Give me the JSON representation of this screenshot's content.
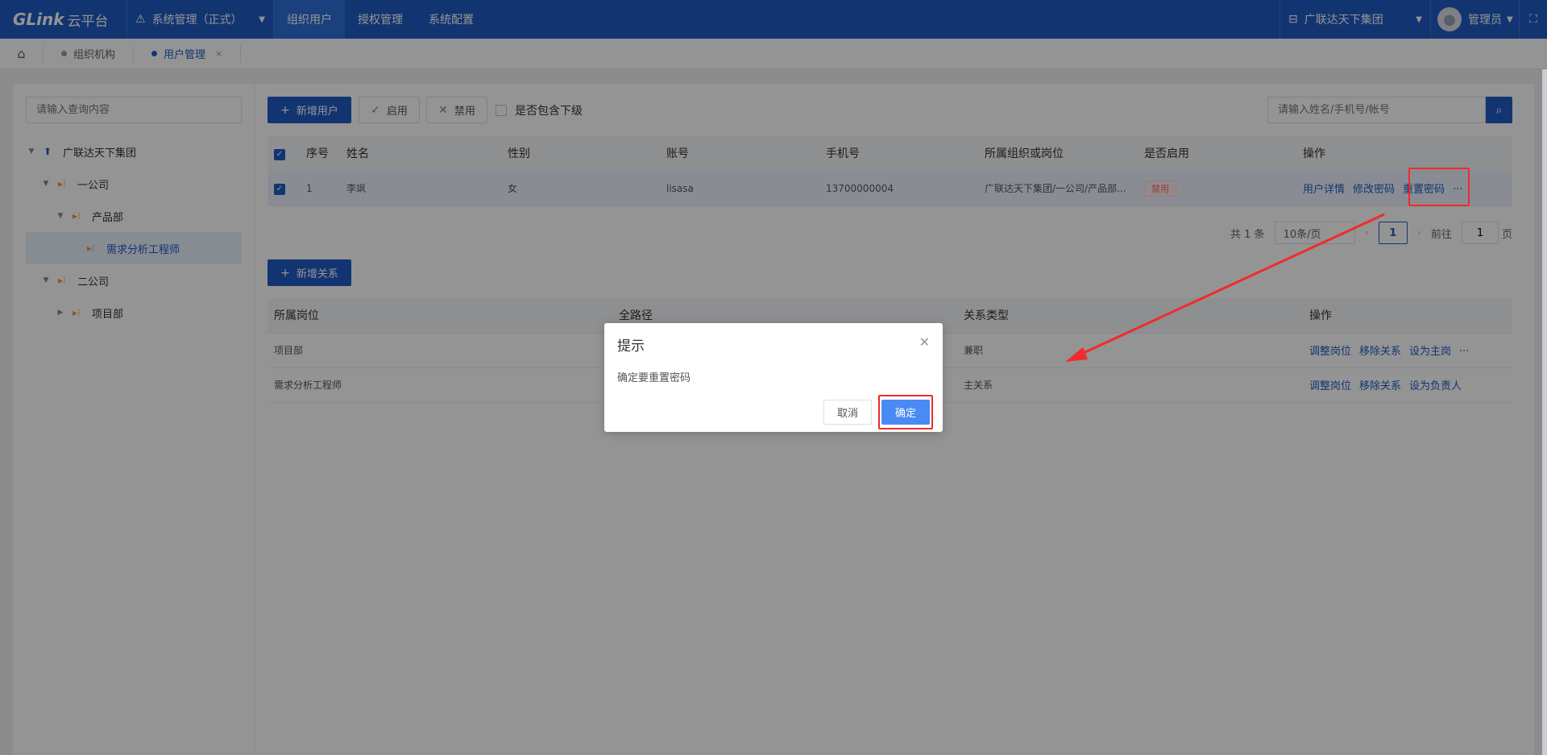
{
  "header": {
    "logo_main": "GLink",
    "logo_suffix": "云平台",
    "system_menu": "系统管理（正式）",
    "nav_tabs": [
      {
        "label": "组织用户",
        "active": true
      },
      {
        "label": "授权管理"
      },
      {
        "label": "系统配置"
      }
    ],
    "org_select": "广联达天下集团",
    "user_name": "管理员"
  },
  "page_tabs": [
    {
      "label": "组织机构"
    },
    {
      "label": "用户管理",
      "active": true
    }
  ],
  "tree": {
    "search_placeholder": "请输入查询内容",
    "nodes": [
      {
        "label": "广联达天下集团",
        "expanded": true
      },
      {
        "label": "一公司",
        "expanded": true
      },
      {
        "label": "产品部",
        "expanded": true
      },
      {
        "label": "需求分析工程师",
        "selected": true
      },
      {
        "label": "二公司",
        "expanded": true
      },
      {
        "label": "项目部",
        "expanded": false
      }
    ]
  },
  "toolbar": {
    "add_user": "新增用户",
    "enable": "启用",
    "disable": "禁用",
    "include_sub": "是否包含下级",
    "search_placeholder": "请输入姓名/手机号/帐号"
  },
  "user_table": {
    "columns": [
      "序号",
      "姓名",
      "性别",
      "账号",
      "手机号",
      "所属组织或岗位",
      "是否启用",
      "操作"
    ],
    "rows": [
      {
        "index": "1",
        "name": "李飒",
        "gender": "女",
        "account": "lisasa",
        "phone": "13700000004",
        "org": "广联达天下集团/一公司/产品部...",
        "status": "禁用",
        "actions": [
          "用户详情",
          "修改密码",
          "重置密码",
          "···"
        ]
      }
    ]
  },
  "pagination": {
    "total": "共 1 条",
    "page_size": "10条/页",
    "current": "1",
    "goto_label": "前往",
    "goto_value": "1",
    "page_suffix": "页"
  },
  "relation": {
    "add_relation": "新增关系",
    "columns": [
      "所属岗位",
      "全路径",
      "关系类型",
      "操作"
    ],
    "rows": [
      {
        "post": "项目部",
        "path": "",
        "type": "兼职",
        "actions": [
          "调整岗位",
          "移除关系",
          "设为主岗",
          "···"
        ]
      },
      {
        "post": "需求分析工程师",
        "path": "",
        "type": "主关系",
        "actions": [
          "调整岗位",
          "移除关系",
          "设为负责人"
        ]
      }
    ]
  },
  "dialog": {
    "title": "提示",
    "message": "确定要重置密码",
    "cancel": "取消",
    "confirm": "确定"
  },
  "colors": {
    "brand": "#1f5cc4",
    "confirm": "#4a8af4",
    "highlight": "#f02b2b"
  }
}
